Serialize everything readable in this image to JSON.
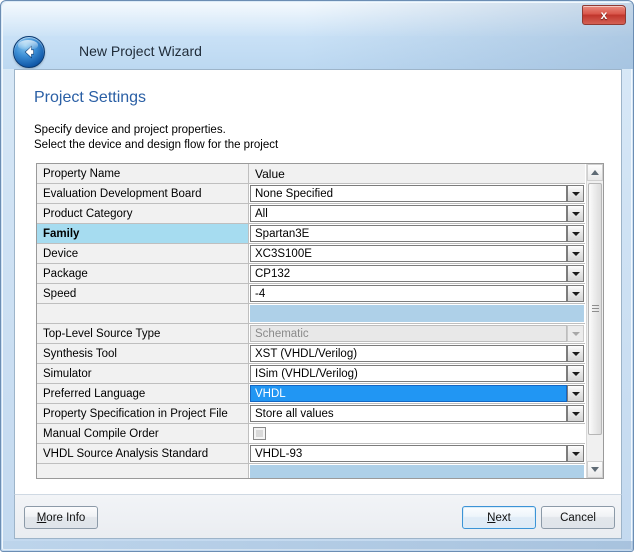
{
  "window": {
    "wizard_title": "New Project Wizard",
    "close_label": "x",
    "back_icon": "back-arrow-icon",
    "frame_color": "#6b8db3",
    "titlebar_color": "#c9e1f6"
  },
  "page": {
    "title": "Project Settings",
    "title_color": "#2a5fa5",
    "description_line1": "Specify device and project properties.",
    "description_line2": "Select the device and design flow for the project"
  },
  "grid": {
    "columns": [
      "Property Name",
      "Value"
    ],
    "selected_row_color": "#a6dcf0",
    "selected_value_color": "#2196f3",
    "blank_row_color": "#aed0e8",
    "rows": [
      {
        "name": "Evaluation Development Board",
        "value": "None Specified",
        "control": "dropdown",
        "state": "normal"
      },
      {
        "name": "Product Category",
        "value": "All",
        "control": "dropdown",
        "state": "normal"
      },
      {
        "name": "Family",
        "value": "Spartan3E",
        "control": "dropdown",
        "state": "normal",
        "name_selected": true
      },
      {
        "name": "Device",
        "value": "XC3S100E",
        "control": "dropdown",
        "state": "normal"
      },
      {
        "name": "Package",
        "value": "CP132",
        "control": "dropdown",
        "state": "normal"
      },
      {
        "name": "Speed",
        "value": "-4",
        "control": "dropdown",
        "state": "normal"
      },
      {
        "name": "",
        "value": "",
        "control": "blank",
        "state": "blank"
      },
      {
        "name": "Top-Level Source Type",
        "value": "Schematic",
        "control": "dropdown",
        "state": "disabled"
      },
      {
        "name": "Synthesis Tool",
        "value": "XST (VHDL/Verilog)",
        "control": "dropdown",
        "state": "normal"
      },
      {
        "name": "Simulator",
        "value": "ISim (VHDL/Verilog)",
        "control": "dropdown",
        "state": "normal"
      },
      {
        "name": "Preferred Language",
        "value": "VHDL",
        "control": "dropdown",
        "state": "selected"
      },
      {
        "name": "Property Specification in Project File",
        "value": "Store all values",
        "control": "dropdown",
        "state": "normal"
      },
      {
        "name": "Manual Compile Order",
        "value": "",
        "control": "checkbox",
        "state": "unchecked"
      },
      {
        "name": "VHDL Source Analysis Standard",
        "value": "VHDL-93",
        "control": "dropdown",
        "state": "normal"
      },
      {
        "name": "",
        "value": "",
        "control": "blank",
        "state": "blank"
      }
    ],
    "scrollbar": {
      "up_icon": "scroll-up-arrow-icon",
      "down_icon": "scroll-down-arrow-icon",
      "thumb_icon": "scroll-thumb-grip-icon"
    }
  },
  "footer": {
    "more_info": {
      "prefix": "",
      "accel": "M",
      "suffix": "ore Info"
    },
    "next": {
      "prefix": "",
      "accel": "N",
      "suffix": "ext"
    },
    "cancel": {
      "prefix": "Cancel",
      "accel": "",
      "suffix": ""
    }
  }
}
